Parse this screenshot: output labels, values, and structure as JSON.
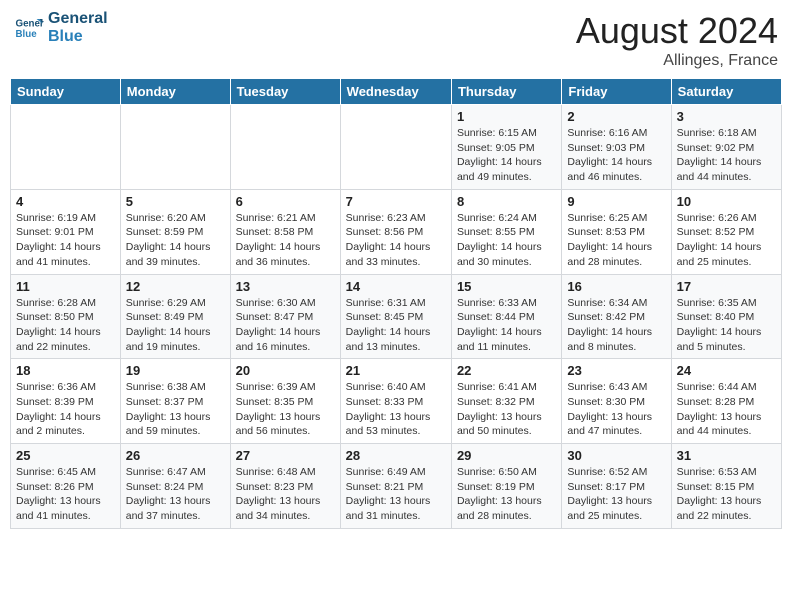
{
  "header": {
    "logo_line1": "General",
    "logo_line2": "Blue",
    "month_year": "August 2024",
    "location": "Allinges, France"
  },
  "weekdays": [
    "Sunday",
    "Monday",
    "Tuesday",
    "Wednesday",
    "Thursday",
    "Friday",
    "Saturday"
  ],
  "weeks": [
    [
      {
        "day": "",
        "info": ""
      },
      {
        "day": "",
        "info": ""
      },
      {
        "day": "",
        "info": ""
      },
      {
        "day": "",
        "info": ""
      },
      {
        "day": "1",
        "info": "Sunrise: 6:15 AM\nSunset: 9:05 PM\nDaylight: 14 hours\nand 49 minutes."
      },
      {
        "day": "2",
        "info": "Sunrise: 6:16 AM\nSunset: 9:03 PM\nDaylight: 14 hours\nand 46 minutes."
      },
      {
        "day": "3",
        "info": "Sunrise: 6:18 AM\nSunset: 9:02 PM\nDaylight: 14 hours\nand 44 minutes."
      }
    ],
    [
      {
        "day": "4",
        "info": "Sunrise: 6:19 AM\nSunset: 9:01 PM\nDaylight: 14 hours\nand 41 minutes."
      },
      {
        "day": "5",
        "info": "Sunrise: 6:20 AM\nSunset: 8:59 PM\nDaylight: 14 hours\nand 39 minutes."
      },
      {
        "day": "6",
        "info": "Sunrise: 6:21 AM\nSunset: 8:58 PM\nDaylight: 14 hours\nand 36 minutes."
      },
      {
        "day": "7",
        "info": "Sunrise: 6:23 AM\nSunset: 8:56 PM\nDaylight: 14 hours\nand 33 minutes."
      },
      {
        "day": "8",
        "info": "Sunrise: 6:24 AM\nSunset: 8:55 PM\nDaylight: 14 hours\nand 30 minutes."
      },
      {
        "day": "9",
        "info": "Sunrise: 6:25 AM\nSunset: 8:53 PM\nDaylight: 14 hours\nand 28 minutes."
      },
      {
        "day": "10",
        "info": "Sunrise: 6:26 AM\nSunset: 8:52 PM\nDaylight: 14 hours\nand 25 minutes."
      }
    ],
    [
      {
        "day": "11",
        "info": "Sunrise: 6:28 AM\nSunset: 8:50 PM\nDaylight: 14 hours\nand 22 minutes."
      },
      {
        "day": "12",
        "info": "Sunrise: 6:29 AM\nSunset: 8:49 PM\nDaylight: 14 hours\nand 19 minutes."
      },
      {
        "day": "13",
        "info": "Sunrise: 6:30 AM\nSunset: 8:47 PM\nDaylight: 14 hours\nand 16 minutes."
      },
      {
        "day": "14",
        "info": "Sunrise: 6:31 AM\nSunset: 8:45 PM\nDaylight: 14 hours\nand 13 minutes."
      },
      {
        "day": "15",
        "info": "Sunrise: 6:33 AM\nSunset: 8:44 PM\nDaylight: 14 hours\nand 11 minutes."
      },
      {
        "day": "16",
        "info": "Sunrise: 6:34 AM\nSunset: 8:42 PM\nDaylight: 14 hours\nand 8 minutes."
      },
      {
        "day": "17",
        "info": "Sunrise: 6:35 AM\nSunset: 8:40 PM\nDaylight: 14 hours\nand 5 minutes."
      }
    ],
    [
      {
        "day": "18",
        "info": "Sunrise: 6:36 AM\nSunset: 8:39 PM\nDaylight: 14 hours\nand 2 minutes."
      },
      {
        "day": "19",
        "info": "Sunrise: 6:38 AM\nSunset: 8:37 PM\nDaylight: 13 hours\nand 59 minutes."
      },
      {
        "day": "20",
        "info": "Sunrise: 6:39 AM\nSunset: 8:35 PM\nDaylight: 13 hours\nand 56 minutes."
      },
      {
        "day": "21",
        "info": "Sunrise: 6:40 AM\nSunset: 8:33 PM\nDaylight: 13 hours\nand 53 minutes."
      },
      {
        "day": "22",
        "info": "Sunrise: 6:41 AM\nSunset: 8:32 PM\nDaylight: 13 hours\nand 50 minutes."
      },
      {
        "day": "23",
        "info": "Sunrise: 6:43 AM\nSunset: 8:30 PM\nDaylight: 13 hours\nand 47 minutes."
      },
      {
        "day": "24",
        "info": "Sunrise: 6:44 AM\nSunset: 8:28 PM\nDaylight: 13 hours\nand 44 minutes."
      }
    ],
    [
      {
        "day": "25",
        "info": "Sunrise: 6:45 AM\nSunset: 8:26 PM\nDaylight: 13 hours\nand 41 minutes."
      },
      {
        "day": "26",
        "info": "Sunrise: 6:47 AM\nSunset: 8:24 PM\nDaylight: 13 hours\nand 37 minutes."
      },
      {
        "day": "27",
        "info": "Sunrise: 6:48 AM\nSunset: 8:23 PM\nDaylight: 13 hours\nand 34 minutes."
      },
      {
        "day": "28",
        "info": "Sunrise: 6:49 AM\nSunset: 8:21 PM\nDaylight: 13 hours\nand 31 minutes."
      },
      {
        "day": "29",
        "info": "Sunrise: 6:50 AM\nSunset: 8:19 PM\nDaylight: 13 hours\nand 28 minutes."
      },
      {
        "day": "30",
        "info": "Sunrise: 6:52 AM\nSunset: 8:17 PM\nDaylight: 13 hours\nand 25 minutes."
      },
      {
        "day": "31",
        "info": "Sunrise: 6:53 AM\nSunset: 8:15 PM\nDaylight: 13 hours\nand 22 minutes."
      }
    ]
  ]
}
